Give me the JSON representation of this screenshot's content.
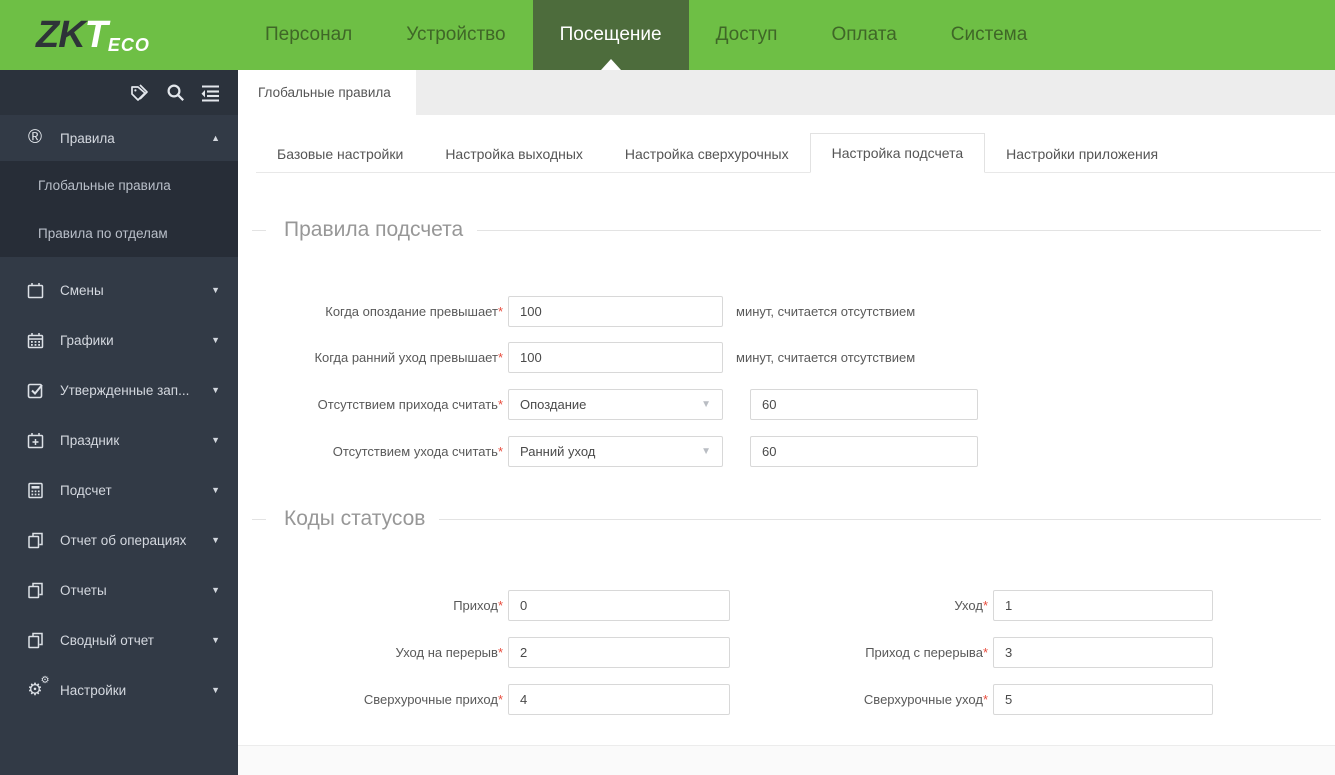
{
  "icons": {
    "arrow_up": "▲",
    "arrow_down": "▼",
    "dropdown_arrow": "▼",
    "required_mark": "*",
    "registered_glyph": "®",
    "gear_glyph": "⚙"
  },
  "colors": {
    "brand_green": "#6ebf45",
    "nav_active_bg": "#4d6c3c",
    "sidebar_bg": "#323a46",
    "sidebar_submenu_bg": "#272d37",
    "required_red": "#e84c3d"
  },
  "header": {
    "logo_zk": "ZK",
    "logo_t": "T",
    "logo_eco": "ECO",
    "nav": [
      {
        "label": "Персонал"
      },
      {
        "label": "Устройство"
      },
      {
        "label": "Посещение",
        "active": true
      },
      {
        "label": "Доступ"
      },
      {
        "label": "Оплата"
      },
      {
        "label": "Система"
      }
    ]
  },
  "sidebar": {
    "rules_item": {
      "label": "Правила"
    },
    "rules_children": [
      {
        "label": "Глобальные правила"
      },
      {
        "label": "Правила по отделам"
      }
    ],
    "items": [
      {
        "icon": "calendar-icon",
        "label": "Смены"
      },
      {
        "icon": "calendar-grid-icon",
        "label": "Графики"
      },
      {
        "icon": "checkbox-icon",
        "label": "Утвержденные зап..."
      },
      {
        "icon": "calendar-plus-icon",
        "label": "Праздник"
      },
      {
        "icon": "calculator-icon",
        "label": "Подсчет"
      },
      {
        "icon": "pages-icon",
        "label": "Отчет об операциях"
      },
      {
        "icon": "pages-icon",
        "label": "Отчеты"
      },
      {
        "icon": "pages-icon",
        "label": "Сводный отчет"
      },
      {
        "icon": "gears-icon",
        "label": "Настройки"
      }
    ]
  },
  "page_tab": {
    "label": "Глобальные правила"
  },
  "subtabs": {
    "active_index": 3,
    "items": [
      {
        "label": "Базовые настройки"
      },
      {
        "label": "Настройка выходных"
      },
      {
        "label": "Настройка сверхурочных"
      },
      {
        "label": "Настройка подсчета"
      },
      {
        "label": "Настройки приложения"
      }
    ]
  },
  "calc_rules": {
    "title": "Правила подсчета",
    "rows": [
      {
        "label": "Когда опоздание превышает",
        "value": "100",
        "suffix": "минут, считается отсутствием"
      },
      {
        "label": "Когда ранний уход превышает",
        "value": "100",
        "suffix": "минут, считается отсутствием"
      },
      {
        "label": "Отсутствием прихода считать",
        "select_value": "Опоздание",
        "value": "60"
      },
      {
        "label": "Отсутствием ухода считать",
        "select_value": "Ранний уход",
        "value": "60"
      }
    ]
  },
  "status_codes": {
    "title": "Коды статусов",
    "rows": [
      {
        "left_label": "Приход",
        "left_value": "0",
        "right_label": "Уход",
        "right_value": "1"
      },
      {
        "left_label": "Уход на перерыв",
        "left_value": "2",
        "right_label": "Приход с перерыва",
        "right_value": "3"
      },
      {
        "left_label": "Сверхурочные приход",
        "left_value": "4",
        "right_label": "Сверхурочные уход",
        "right_value": "5"
      }
    ]
  }
}
